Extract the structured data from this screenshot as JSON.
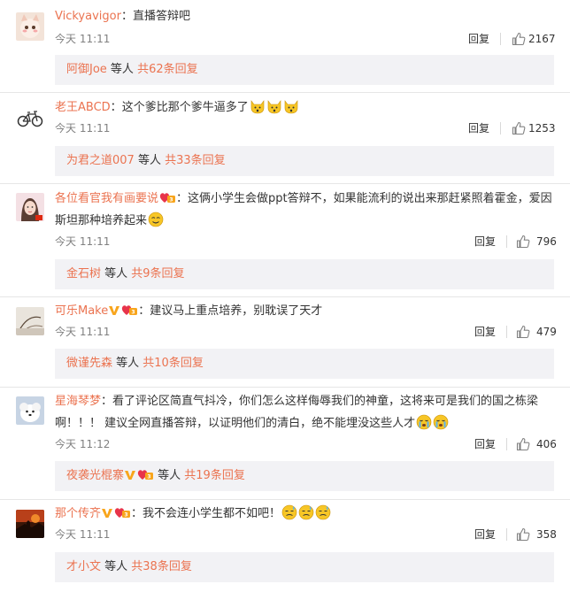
{
  "comments": [
    {
      "username": "Vickyavigor",
      "separator": "：",
      "text": "直播答辩吧",
      "time": "今天 11:11",
      "reply_label": "回复",
      "likes": "2167",
      "more": {
        "names": "阿御Joe",
        "mid": " 等人 ",
        "link": "共62条回复"
      }
    },
    {
      "username": "老王ABCD",
      "separator": "：",
      "text": "这个爹比那个爹牛逼多了",
      "time": "今天 11:11",
      "reply_label": "回复",
      "likes": "1253",
      "more": {
        "names": "为君之道007",
        "mid": " 等人 ",
        "link": "共33条回复"
      }
    },
    {
      "username": "各位看官我有画要说",
      "separator": "：",
      "text_line1": "这俩小学生会做ppt答辩不，如果能流利的说出来那赶紧照着霍金，爱因",
      "text_line2": "斯坦那种培养起来",
      "time": "今天 11:11",
      "reply_label": "回复",
      "likes": "796",
      "more": {
        "names": "金石树",
        "mid": " 等人 ",
        "link": "共9条回复"
      }
    },
    {
      "username": "可乐Make",
      "separator": "：",
      "text": "建议马上重点培养，别耽误了天才",
      "time": "今天 11:11",
      "reply_label": "回复",
      "likes": "479",
      "more": {
        "names": "微谨先森",
        "mid": " 等人 ",
        "link": "共10条回复"
      }
    },
    {
      "username": "星海琴梦",
      "separator": "：",
      "text_line1": "看了评论区简直气抖冷，你们怎么这样侮辱我们的神童，这将来可是我们的国之栋梁",
      "text_line2": "啊！！！ 建议全网直播答辩，以证明他们的清白，绝不能埋没这些人才",
      "time": "今天 11:12",
      "reply_label": "回复",
      "likes": "406",
      "more": {
        "names": "夜袭光棍寨",
        "mid": " 等人 ",
        "link": "共19条回复"
      }
    },
    {
      "username": "那个传齐",
      "separator": "：",
      "text": "我不会连小学生都不如吧！",
      "time": "今天 11:11",
      "reply_label": "回复",
      "likes": "358",
      "more": {
        "names": "才小文",
        "mid": " 等人 ",
        "link": "共38条回复"
      }
    }
  ],
  "colors": {
    "username": "#eb7350",
    "more_bg": "#f2f2f5",
    "vip": "#f8a51c",
    "emoji": "#f7c626"
  }
}
